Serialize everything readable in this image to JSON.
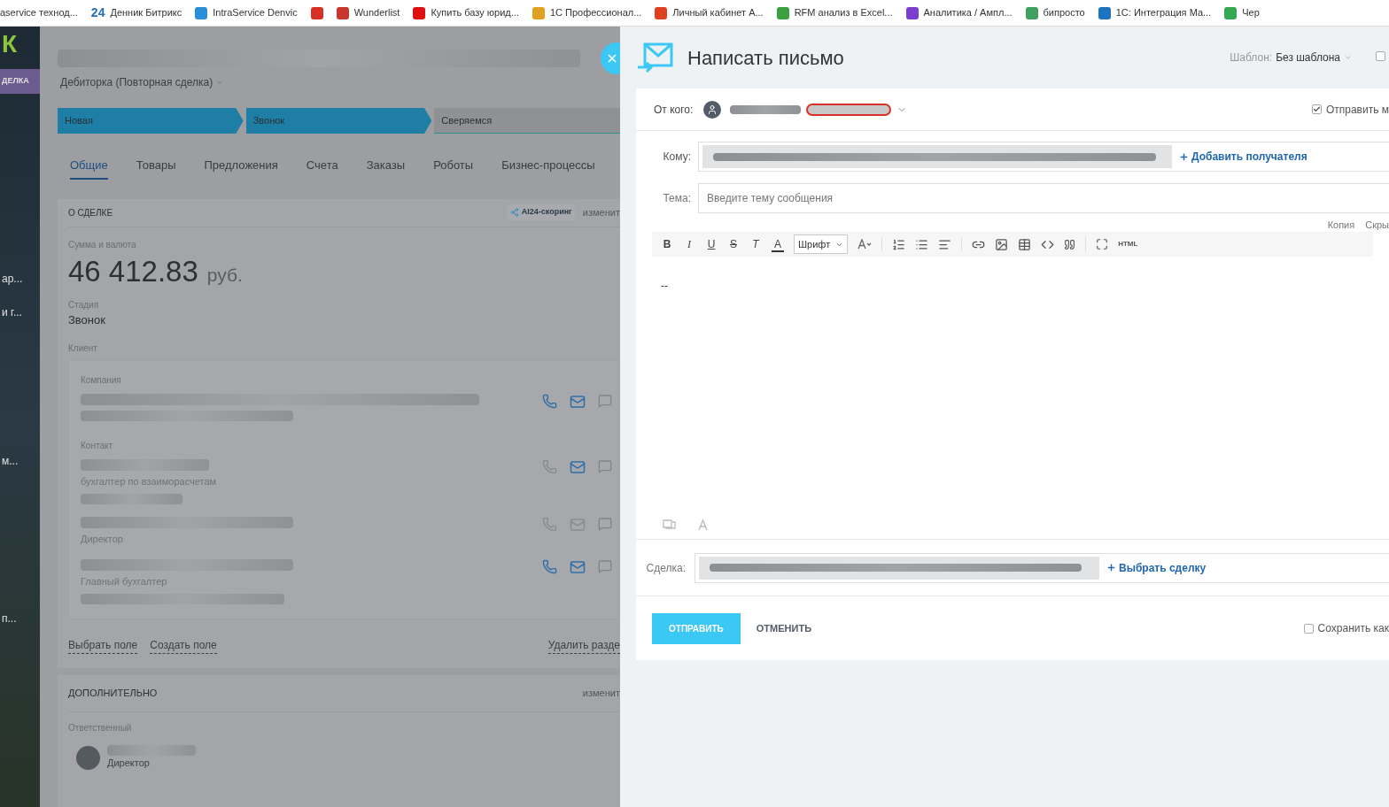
{
  "bookmarks": [
    {
      "label": "aservice технод..."
    },
    {
      "label": "Денник Битрикс",
      "badge": "24",
      "color": "#1e6fb8"
    },
    {
      "label": "IntraService Denvic",
      "color": "#2a8fd6"
    },
    {
      "color": "#d93025"
    },
    {
      "label": "Wunderlist",
      "color": "#c8372d"
    },
    {
      "label": "Купить базу юрид...",
      "color": "#e01010"
    },
    {
      "label": "1С Профессионал...",
      "color": "#e0a020"
    },
    {
      "label": "Личный кабинет А...",
      "color": "#e04020"
    },
    {
      "label": "RFM анализ в Excel...",
      "color": "#3aa040"
    },
    {
      "label": "Аналитика / Ампл...",
      "color": "#7a3fd0"
    },
    {
      "label": "бипросто",
      "color": "#40a060"
    },
    {
      "label": "1С: Интеграция Ма...",
      "color": "#1e73be"
    },
    {
      "label": "Чер",
      "color": "#34a853"
    }
  ],
  "sidebar": {
    "logo": "К",
    "badge": "ДЕЛКА",
    "items": [
      "ар...",
      "и г...",
      "м...",
      "п..."
    ]
  },
  "deal": {
    "category": "Дебиторка (Повторная сделка)",
    "stages": [
      {
        "label": "Новая",
        "done": true
      },
      {
        "label": "Звонок",
        "done": true
      },
      {
        "label": "Сверяемся",
        "done": false
      }
    ],
    "tabs": [
      {
        "label": "Общие",
        "selected": true
      },
      {
        "label": "Товары",
        "selected": false
      },
      {
        "label": "Предложения",
        "selected": false
      },
      {
        "label": "Счета",
        "selected": false
      },
      {
        "label": "Заказы",
        "selected": false
      },
      {
        "label": "Роботы",
        "selected": false
      },
      {
        "label": "Бизнес-процессы",
        "selected": false
      }
    ],
    "section_title": "О СДЕЛКЕ",
    "scoring": "AI24-скоринг",
    "edit": "изменит",
    "amount_label": "Сумма и валюта",
    "amount": "46 412.83",
    "currency": "руб.",
    "stage_label": "Стадия",
    "stage": "Звонок",
    "client_label": "Клиент",
    "company_label": "Компания",
    "contact_label": "Контакт",
    "clients": [
      {
        "kind": "company",
        "phone": true,
        "mail": true
      },
      {
        "kind": "contact",
        "role": "бухгалтер по взаиморасчетам",
        "phone": false,
        "mail": true
      },
      {
        "kind": "contact",
        "role": "Директор",
        "phone": false,
        "mail": false
      },
      {
        "kind": "contact",
        "role": "Главный бухгалтер",
        "phone": true,
        "mail": true
      }
    ],
    "links": [
      "Выбрать поле",
      "Создать поле"
    ],
    "delete_link": "Удалить разде",
    "extra_title": "ДОПОЛНИТЕЛЬНО",
    "extra_edit": "изменит",
    "responsible_label": "Ответственный",
    "responsible_role": "Директор"
  },
  "mail": {
    "title": "Написать письмо",
    "template_label": "Шаблон:",
    "template": "Без шаблона",
    "header_checkbox": {
      "checked": false
    },
    "from_label": "От кого:",
    "send_copy": {
      "label": "Отправить м",
      "checked": true
    },
    "to_label": "Кому:",
    "add_recipient": "Добавить получателя",
    "subject_label": "Тема:",
    "subject_placeholder": "Введите тему сообщения",
    "cc": "Копия",
    "bcc": "Скры",
    "format_buttons": [
      "B",
      "I",
      "U",
      "S",
      "T"
    ],
    "text_color": "A",
    "font_select": "Шрифт",
    "html": "HTML",
    "body": "--",
    "deal_label": "Сделка:",
    "choose_deal": "Выбрать сделку",
    "send": "ОТПРАВИТЬ",
    "cancel": "ОТМЕНИТЬ",
    "save_template": {
      "label": "Сохранить как",
      "checked": false
    }
  }
}
